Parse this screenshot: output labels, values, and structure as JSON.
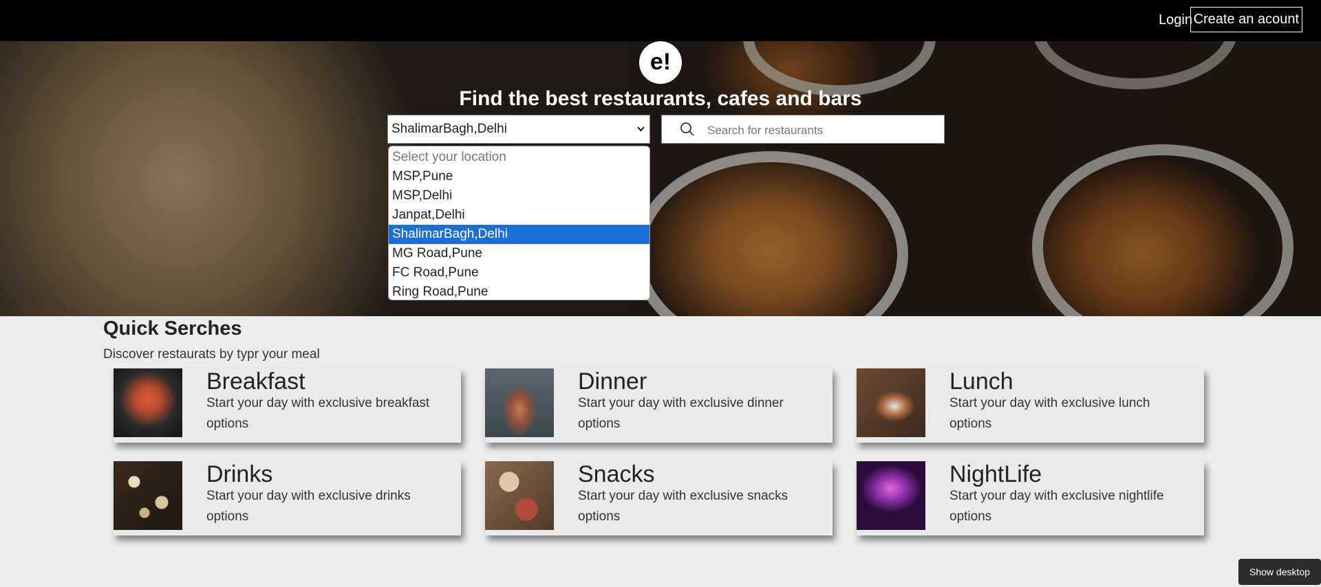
{
  "topbar": {
    "login": "Login",
    "create_account": "Create an acount"
  },
  "hero": {
    "logo": "e!",
    "headline": "Find the best restaurants, cafes and bars",
    "location_selected": "ShalimarBagh,Delhi",
    "search_placeholder": "Search for restaurants",
    "location_options": [
      "Select your location",
      "MSP,Pune",
      "MSP,Delhi",
      "Janpat,Delhi",
      "ShalimarBagh,Delhi",
      "MG Road,Pune",
      "FC Road,Pune",
      "Ring Road,Pune"
    ]
  },
  "quick": {
    "title": "Quick Serches",
    "subtitle": "Discover restaurats by typr your meal",
    "cards": [
      {
        "title": "Breakfast",
        "desc": "Start your day with exclusive breakfast options"
      },
      {
        "title": "Dinner",
        "desc": "Start your day with exclusive dinner options"
      },
      {
        "title": "Lunch",
        "desc": "Start your day with exclusive lunch options"
      },
      {
        "title": "Drinks",
        "desc": "Start your day with exclusive drinks options"
      },
      {
        "title": "Snacks",
        "desc": "Start your day with exclusive snacks options"
      },
      {
        "title": "NightLife",
        "desc": "Start your day with exclusive nightlife options"
      }
    ]
  },
  "taskbar": {
    "show_desktop": "Show desktop"
  },
  "colors": {
    "topbar": "#000000",
    "selected_option": "#1a6fd4",
    "page_bg": "#ececec"
  }
}
